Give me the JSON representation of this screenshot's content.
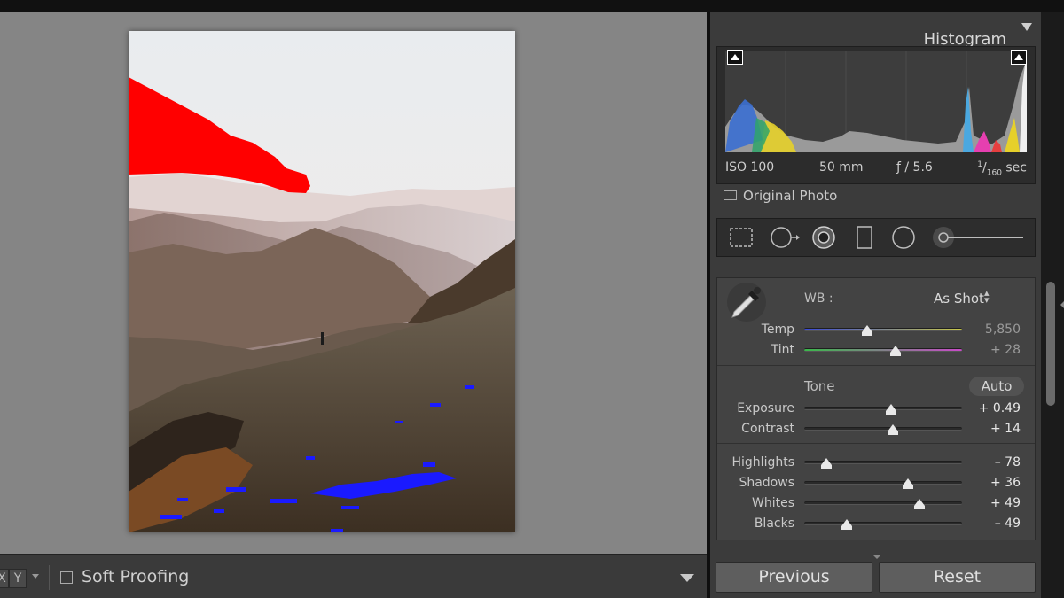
{
  "histogram": {
    "title": "Histogram",
    "exif": {
      "iso": "ISO 100",
      "focal": "50 mm",
      "aperture": "ƒ / 5.6",
      "shutter_num": "1",
      "shutter_den": "160",
      "shutter_unit": " sec"
    },
    "original_photo_label": "Original Photo"
  },
  "tool_strip": {
    "tools": [
      "crop-overlay-icon",
      "spot-removal-icon",
      "red-eye-icon",
      "graduated-filter-icon",
      "radial-filter-icon",
      "adjustment-brush-icon"
    ]
  },
  "basic": {
    "wb_label": "WB :",
    "wb_value": "As Shot",
    "tone_label": "Tone",
    "auto_label": "Auto",
    "sliders": {
      "temp": {
        "label": "Temp",
        "value": "5,850",
        "pos": 0.4
      },
      "tint": {
        "label": "Tint",
        "value": "+ 28",
        "pos": 0.58
      },
      "exposure": {
        "label": "Exposure",
        "value": "+ 0.49",
        "pos": 0.55
      },
      "contrast": {
        "label": "Contrast",
        "value": "+ 14",
        "pos": 0.56
      },
      "highlights": {
        "label": "Highlights",
        "value": "– 78",
        "pos": 0.14
      },
      "shadows": {
        "label": "Shadows",
        "value": "+ 36",
        "pos": 0.66
      },
      "whites": {
        "label": "Whites",
        "value": "+ 49",
        "pos": 0.73
      },
      "blacks": {
        "label": "Blacks",
        "value": "– 49",
        "pos": 0.27
      }
    }
  },
  "buttons": {
    "previous": "Previous",
    "reset": "Reset"
  },
  "toolbar": {
    "yx_label": "X",
    "y_label": "Y",
    "soft_proofing_label": "Soft Proofing"
  },
  "colors": {
    "clip_highlight": "#ff0000",
    "clip_shadow": "#1a1aff",
    "panel_bg": "#3b3b3b",
    "canvas_bg": "#858585"
  }
}
